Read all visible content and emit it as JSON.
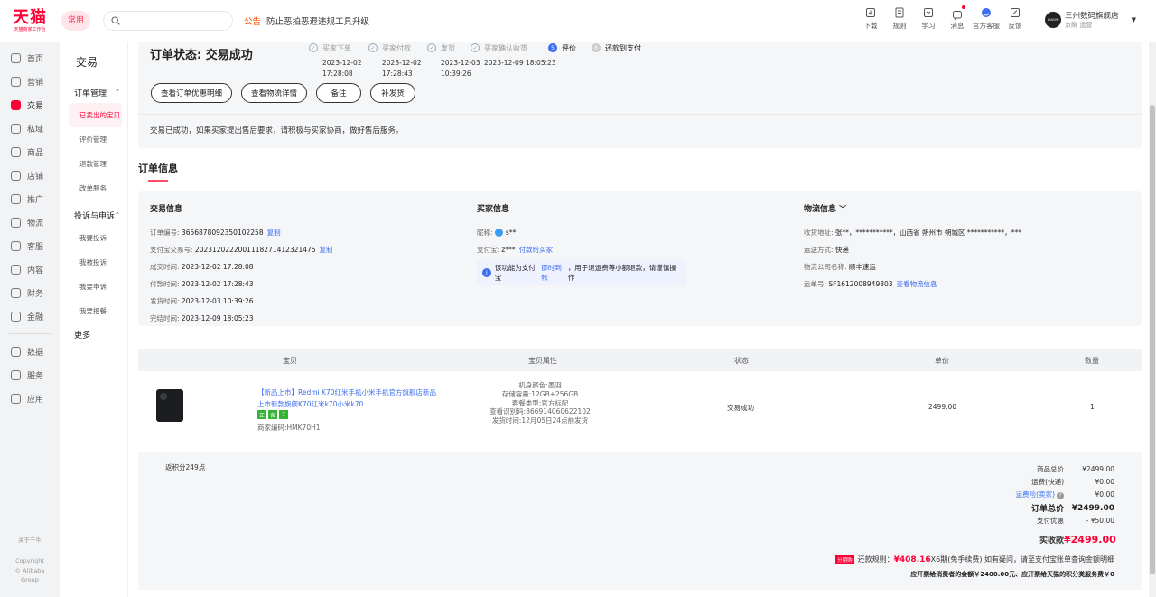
{
  "brand": {
    "logo": "天猫",
    "slogan": "天猫商家工作台",
    "chip": "常用"
  },
  "search": {
    "placeholder": ""
  },
  "notice": {
    "tag": "公告",
    "text": "防止恶拍恶退违规工具升级"
  },
  "tools": [
    {
      "label": "下载",
      "icon": "download-icon"
    },
    {
      "label": "规则",
      "icon": "rules-icon"
    },
    {
      "label": "学习",
      "icon": "learn-icon"
    },
    {
      "label": "消息",
      "icon": "message-icon"
    },
    {
      "label": "官方客服",
      "icon": "service-icon"
    },
    {
      "label": "反馈",
      "icon": "feedback-icon"
    }
  ],
  "user": {
    "avatar": "XIAOMI",
    "name": "三州数码旗舰店",
    "sub": "京瞬",
    "role": "运营"
  },
  "leftnav": {
    "items": [
      "首页",
      "营销",
      "交易",
      "私域",
      "商品",
      "店铺",
      "推广",
      "物流",
      "客服",
      "内容",
      "财务",
      "金融"
    ],
    "items2": [
      "数据",
      "服务",
      "应用"
    ],
    "about": "关于千牛",
    "copyright1": "Copyright",
    "copyright2": "© Alibaba",
    "copyright3": "Group"
  },
  "subnav": {
    "title": "交易",
    "group1": "订单管理",
    "group1_items": [
      "已卖出的宝贝",
      "评价管理",
      "退款管理",
      "改单服务"
    ],
    "group2": "投诉与申诉",
    "group2_items": [
      "我要投诉",
      "我被投诉",
      "我要申诉",
      "我要报餐"
    ],
    "more": "更多"
  },
  "status": {
    "title": "订单状态: 交易成功",
    "steps": [
      {
        "label": "买家下单",
        "time1": "2023-12-02",
        "time2": "17:28:08"
      },
      {
        "label": "买家付款",
        "time1": "2023-12-02",
        "time2": "17:28:43"
      },
      {
        "label": "发货",
        "time1": "2023-12-03",
        "time2": "10:39:26"
      },
      {
        "label": "买家确认收货",
        "time1": "2023-12-09 18:05:23",
        "time2": ""
      },
      {
        "label": "评价",
        "num": "5"
      },
      {
        "label": "还款到支付",
        "num": "6"
      }
    ],
    "buttons": [
      "查看订单优惠明细",
      "查看物流详情",
      "备注",
      "补发货"
    ],
    "desc": "交易已成功，如果买家提出售后要求，请积极与买家协商，做好售后服务。"
  },
  "order_info": {
    "section_title": "订单信息",
    "trade": {
      "title": "交易信息",
      "rows": [
        {
          "k": "订单编号:",
          "v": "3656878092350102258",
          "link": "复制"
        },
        {
          "k": "支付宝交易号:",
          "v": "2023120222001118271412321475",
          "link": "复制"
        },
        {
          "k": "成交时间:",
          "v": "2023-12-02 17:28:08"
        },
        {
          "k": "付款时间:",
          "v": "2023-12-02 17:28:43"
        },
        {
          "k": "发货时间:",
          "v": "2023-12-03 10:39:26"
        },
        {
          "k": "完结时间:",
          "v": "2023-12-09 18:05:23"
        }
      ]
    },
    "buyer": {
      "title": "买家信息",
      "nick_k": "昵称:",
      "nick_v": "s**",
      "alipay_k": "支付宝:",
      "alipay_v": "z***",
      "alipay_link": "付款给买家",
      "tip_a": "该功能为支付宝",
      "tip_link": "即时到帐",
      "tip_b": "，用于退运费等小额退款，请谨慎操作"
    },
    "logistics": {
      "title": "物流信息",
      "rows": [
        {
          "k": "收货地址:",
          "v": "张**，***********，山西省 朔州市 朔城区 ***********，***"
        },
        {
          "k": "运送方式:",
          "v": "快递"
        },
        {
          "k": "物流公司名称:",
          "v": "顺丰速运"
        },
        {
          "k": "运单号:",
          "v": "SF1612008949803",
          "link": "查看物流信息"
        }
      ]
    }
  },
  "table": {
    "headers": [
      "宝贝",
      "宝贝属性",
      "状态",
      "单价",
      "数量"
    ],
    "item": {
      "title": "【新品上市】Redmi K70红米手机小米手机官方旗舰店新品上市新款旗舰K70红米k70小米k70",
      "tags": [
        "正",
        "舍",
        "7"
      ],
      "code": "商家编码:HMK70H1",
      "attrs": [
        "机身颜色:墨羽",
        "存储容量:12GB+256GB",
        "套餐类型:官方标配",
        "查看识别码:866914060622102",
        "发货时间:12月05日24点前发货"
      ],
      "status": "交易成功",
      "price": "2499.00",
      "qty": "1"
    }
  },
  "summary": {
    "points": "返积分249点",
    "rows": [
      {
        "k": "商品总价",
        "v": "¥2499.00"
      },
      {
        "k": "运费(快递)",
        "v": "¥0.00"
      },
      {
        "k": "运费险(卖家)",
        "v": "¥0.00"
      }
    ],
    "total_k": "订单总价",
    "total_v": "¥2499.00",
    "discount_k": "支付优惠",
    "discount_v": "- ¥50.00",
    "pay_k": "实收款",
    "pay_v": "¥2499.00",
    "installment_badge": "分期购",
    "installment_a": "还款规则：",
    "installment_amt": "¥408.16",
    "installment_b": "X6期(免手续费) 如有疑问，请至支付宝账单查询金额明细",
    "final_note": "应开票给消费者的金额￥2400.00元、应开票给天猫的积分类服务费￥0"
  },
  "colors": {
    "accent": "#ff0036",
    "link": "#3b6df2"
  }
}
